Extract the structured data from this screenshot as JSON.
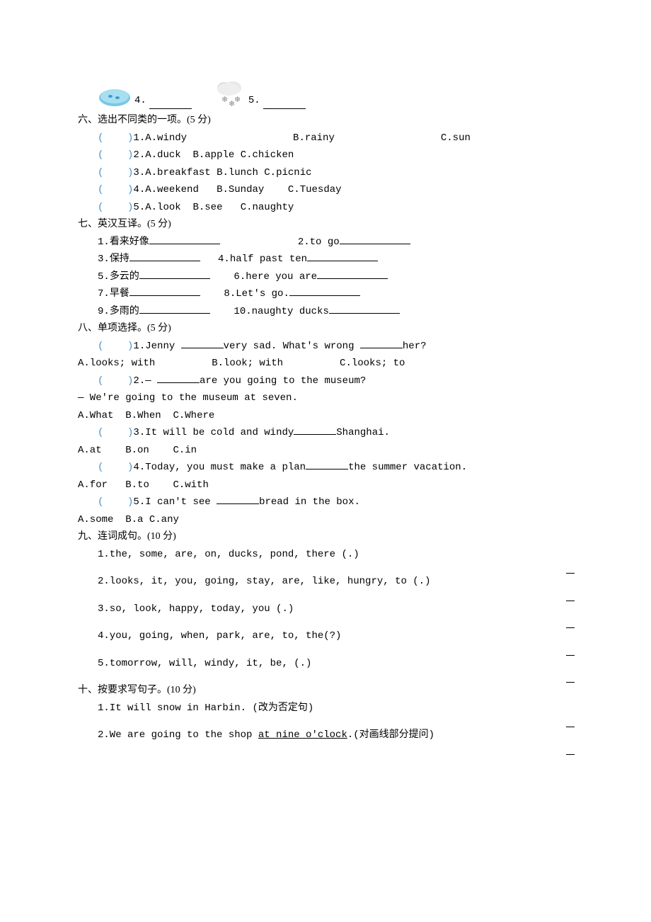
{
  "images": {
    "num4": "4.",
    "num5": "5."
  },
  "section6": {
    "title": "六、选出不同类的一项。(5 分)",
    "items": [
      {
        "num": "1.",
        "a": "A.windy",
        "b": "B.rainy",
        "c": "C.sun"
      },
      {
        "num": "2.",
        "a": "A.duck",
        "b": "B.apple",
        "c": "C.chicken"
      },
      {
        "num": "3.",
        "a": "A.breakfast",
        "b": "B.lunch",
        "c": "C.picnic"
      },
      {
        "num": "4.",
        "a": "A.weekend",
        "b": "B.Sunday",
        "c": "C.Tuesday"
      },
      {
        "num": "5.",
        "a": "A.look",
        "b": "B.see",
        "c": "C.naughty"
      }
    ]
  },
  "section7": {
    "title": "七、英汉互译。(5 分)",
    "items": [
      {
        "left_num": "1.",
        "left": "看来好像",
        "right_num": "2.",
        "right": "to go"
      },
      {
        "left_num": "3.",
        "left": "保持",
        "right_num": "4.",
        "right": "half past ten"
      },
      {
        "left_num": "5.",
        "left": "多云的",
        "right_num": "6.",
        "right": "here you are"
      },
      {
        "left_num": "7.",
        "left": "早餐",
        "right_num": "8.",
        "right": "Let's go."
      },
      {
        "left_num": "9.",
        "left": "多雨的",
        "right_num": "10.",
        "right": "naughty ducks"
      }
    ]
  },
  "section8": {
    "title": "八、单项选择。(5 分)",
    "q1": {
      "num": "1.",
      "pre": "Jenny ",
      "mid": "very sad. What's wrong ",
      "post": "her?"
    },
    "q1_opts": {
      "a": "A.looks; with",
      "b": "B.look; with",
      "c": "C.looks; to"
    },
    "q2": {
      "num": "2.",
      "pre": "— ",
      "post": "are you going to the museum?"
    },
    "q2_line2": "— We're going to the museum at seven.",
    "q2_opts": {
      "a": "A.What",
      "b": "B.When",
      "c": "C.Where"
    },
    "q3": {
      "num": "3.",
      "pre": "It will be cold and windy",
      "post": "Shanghai."
    },
    "q3_opts": {
      "a": "A.at",
      "b": "B.on",
      "c": "C.in"
    },
    "q4": {
      "num": "4.",
      "pre": "Today, you must make a plan",
      "post": "the summer vacation."
    },
    "q4_opts": {
      "a": "A.for",
      "b": "B.to",
      "c": "C.with"
    },
    "q5": {
      "num": "5.",
      "pre": "I can't see ",
      "post": "bread in the box."
    },
    "q5_opts": {
      "a": "A.some",
      "b": "B.a",
      "c": "C.any"
    }
  },
  "section9": {
    "title": "九、连词成句。(10 分)",
    "items": [
      "1.the, some, are, on, ducks, pond, there (.)",
      "2.looks, it, you, going, stay, are, like, hungry, to (.)",
      "3.so, look, happy, today, you (.)",
      "4.you, going, when, park, are, to, the(?)",
      "5.tomorrow, will, windy, it, be, (.)"
    ]
  },
  "section10": {
    "title": "十、按要求写句子。(10 分)",
    "q1": {
      "pre": "1.It will snow in Harbin. ",
      "note": "(改为否定句)"
    },
    "q2": {
      "pre": "2.We are going to the shop ",
      "underline": "at nine o'clock",
      "post": ".",
      "note": "(对画线部分提问)"
    }
  },
  "bracket": "(    )"
}
